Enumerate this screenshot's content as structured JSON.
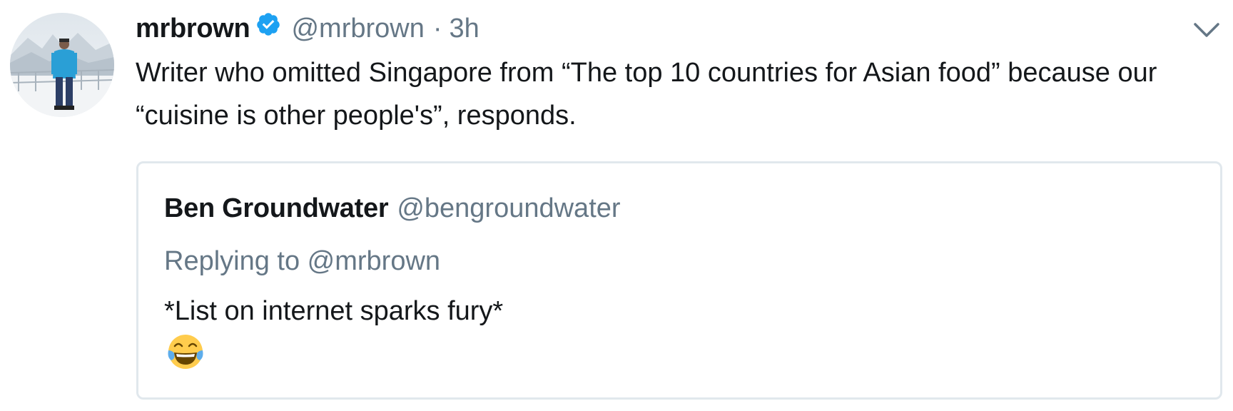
{
  "tweet": {
    "display_name": "mrbrown",
    "verified": true,
    "verified_icon": "verified-badge-icon",
    "handle": "@mrbrown",
    "separator": "·",
    "time": "3h",
    "text": "Writer who omitted Singapore from “The top 10 countries for Asian food” because our “cuisine is other people's”, responds.",
    "menu_icon": "chevron-down-icon",
    "avatar_icon": "profile-photo-avatar"
  },
  "quoted_tweet": {
    "display_name": "Ben Groundwater",
    "handle": "@bengroundwater",
    "reply_context": "Replying to @mrbrown",
    "text": "*List on internet sparks fury*",
    "emoji": "face-with-tears-of-joy-emoji"
  },
  "colors": {
    "text_primary": "#14171a",
    "text_secondary": "#657786",
    "verified_blue": "#1da1f2",
    "border": "#e1e8ed"
  }
}
